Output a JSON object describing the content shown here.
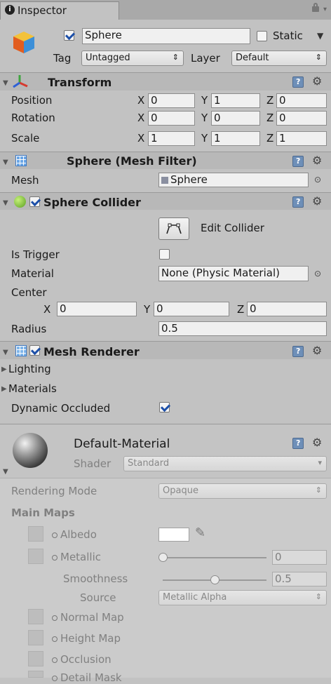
{
  "tab": {
    "title": "Inspector"
  },
  "object": {
    "name": "Sphere",
    "static_label": "Static",
    "tag_label": "Tag",
    "tag_value": "Untagged",
    "layer_label": "Layer",
    "layer_value": "Default"
  },
  "transform": {
    "title": "Transform",
    "rows": [
      {
        "label": "Position",
        "x": "0",
        "y": "1",
        "z": "0"
      },
      {
        "label": "Rotation",
        "x": "0",
        "y": "0",
        "z": "0"
      },
      {
        "label": "Scale",
        "x": "1",
        "y": "1",
        "z": "1"
      }
    ],
    "axis": {
      "x": "X",
      "y": "Y",
      "z": "Z"
    }
  },
  "mesh_filter": {
    "title": "Sphere (Mesh Filter)",
    "mesh_label": "Mesh",
    "mesh_value": "Sphere"
  },
  "sphere_collider": {
    "title": "Sphere Collider",
    "edit_button": "Edit Collider",
    "is_trigger_label": "Is Trigger",
    "material_label": "Material",
    "material_value": "None (Physic Material)",
    "center_label": "Center",
    "center": {
      "x": "0",
      "y": "0",
      "z": "0"
    },
    "radius_label": "Radius",
    "radius_value": "0.5"
  },
  "mesh_renderer": {
    "title": "Mesh Renderer",
    "lighting": "Lighting",
    "materials": "Materials",
    "dynamic_occluded_label": "Dynamic Occluded"
  },
  "material": {
    "name": "Default-Material",
    "shader_label": "Shader",
    "shader_value": "Standard",
    "rendering_mode_label": "Rendering Mode",
    "rendering_mode_value": "Opaque",
    "main_maps": "Main Maps",
    "albedo": "Albedo",
    "metallic": "Metallic",
    "metallic_value": "0",
    "smoothness": "Smoothness",
    "smoothness_value": "0.5",
    "source_label": "Source",
    "source_value": "Metallic Alpha",
    "normal_map": "Normal Map",
    "height_map": "Height Map",
    "occlusion": "Occlusion",
    "detail_mask": "Detail Mask"
  },
  "slider_levels": {
    "metallic": 0.0,
    "smoothness": 0.5
  },
  "colors": {
    "panel_bg": "#c2c2c2",
    "material_bg": "#cbcbcb",
    "check_blue": "#1c4fa8",
    "help_blue": "#6e8fb8"
  }
}
